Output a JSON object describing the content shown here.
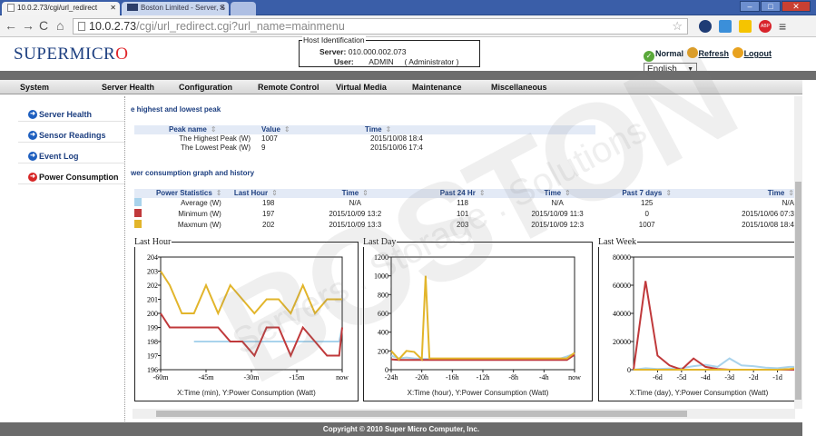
{
  "browser": {
    "tabs": [
      {
        "label": "10.0.2.73/cgi/url_redirect"
      },
      {
        "label": "Boston Limited - Server, S"
      },
      {
        "label": ""
      }
    ],
    "url_host": "10.0.2.73",
    "url_path": "/cgi/url_redirect.cgi?url_name=mainmenu",
    "abp": "ABP"
  },
  "header": {
    "logo": "SUPERMICR",
    "logo_o": "O",
    "host_title": "Host Identification",
    "server_label": "Server:",
    "server_value": "010.000.002.073",
    "user_label": "User:",
    "user_value": "ADMIN",
    "user_role": "( Administrator )",
    "status_text": "Normal",
    "refresh": "Refresh",
    "logout": "Logout",
    "language": "English"
  },
  "nav": [
    "System",
    "Server Health",
    "Configuration",
    "Remote Control",
    "Virtual Media",
    "Maintenance",
    "Miscellaneous"
  ],
  "sidebar": [
    "Server Health",
    "Sensor Readings",
    "Event Log",
    "Power Consumption"
  ],
  "peak_section": {
    "title": "e highest and lowest peak",
    "headers": [
      "Peak name",
      "Value",
      "Time"
    ],
    "rows": [
      [
        "The Highest Peak (W)",
        "1007",
        "2015/10/08 18:4"
      ],
      [
        "The Lowest Peak (W)",
        "9",
        "2015/10/06 17:4"
      ]
    ]
  },
  "power_section": {
    "title": "wer consumption graph and history",
    "headers": [
      "Power Statistics",
      "Last Hour",
      "Time",
      "Past 24 Hr",
      "Time",
      "Past 7 days",
      "Time"
    ],
    "rows": [
      {
        "color": "#a9d3ec",
        "cells": [
          "Average (W)",
          "198",
          "N/A",
          "118",
          "N/A",
          "125",
          "N/A"
        ]
      },
      {
        "color": "#c0393b",
        "cells": [
          "Minimum (W)",
          "197",
          "2015/10/09 13:2",
          "101",
          "2015/10/09 11:3",
          "0",
          "2015/10/06 07:3"
        ]
      },
      {
        "color": "#e2b52b",
        "cells": [
          "Maxmum (W)",
          "202",
          "2015/10/09 13:3",
          "203",
          "2015/10/09 12:3",
          "1007",
          "2015/10/08 18:4"
        ]
      }
    ]
  },
  "charts": {
    "last_hour": {
      "title": "Last Hour",
      "caption": "X:Time (min), Y:Power Consumption (Watt)"
    },
    "last_day": {
      "title": "Last Day",
      "caption": "X:Time (hour), Y:Power Consumption (Watt)"
    },
    "last_week": {
      "title": "Last Week",
      "caption": "X:Time (day), Y:Power Consumption (Watt)"
    }
  },
  "chart_data": [
    {
      "type": "line",
      "title": "Last Hour",
      "xlabel": "X:Time (min), Y:Power Consumption (Watt)",
      "x_ticks": [
        "-60m",
        "-45m",
        "-30m",
        "-15m",
        "now"
      ],
      "y_ticks": [
        196,
        197,
        198,
        199,
        200,
        201,
        202,
        203,
        204
      ],
      "ylim": [
        196,
        204
      ],
      "x": [
        -60,
        -57,
        -53,
        -49,
        -45,
        -41,
        -37,
        -33,
        -29,
        -25,
        -21,
        -17,
        -13,
        -9,
        -5,
        -1,
        0
      ],
      "series": [
        {
          "color": "#a9d3ec",
          "values": [
            null,
            null,
            null,
            198,
            198,
            198,
            198,
            198,
            198,
            198,
            198,
            198,
            198,
            198,
            198,
            198,
            199
          ]
        },
        {
          "color": "#c0393b",
          "values": [
            200,
            199,
            199,
            199,
            199,
            199,
            198,
            198,
            197,
            199,
            199,
            197,
            199,
            198,
            197,
            197,
            199
          ]
        },
        {
          "color": "#e2b52b",
          "values": [
            203,
            202,
            200,
            200,
            202,
            200,
            202,
            201,
            200,
            201,
            201,
            200,
            202,
            200,
            201,
            201,
            201
          ]
        }
      ]
    },
    {
      "type": "line",
      "title": "Last Day",
      "xlabel": "X:Time (hour), Y:Power Consumption (Watt)",
      "x_ticks": [
        "-24h",
        "-20h",
        "-16h",
        "-12h",
        "-8h",
        "-4h",
        "now"
      ],
      "y_ticks": [
        0,
        200,
        400,
        600,
        800,
        1000,
        1200
      ],
      "ylim": [
        0,
        1200
      ],
      "x": [
        -24,
        -23,
        -22,
        -21,
        -20,
        -19.5,
        -19,
        -18,
        -17,
        -16,
        -14,
        -12,
        -10,
        -8,
        -6,
        -4,
        -2,
        -1,
        0
      ],
      "series": [
        {
          "color": "#a9d3ec",
          "values": [
            150,
            120,
            130,
            120,
            115,
            115,
            115,
            115,
            115,
            115,
            115,
            115,
            115,
            115,
            115,
            115,
            115,
            140,
            170
          ]
        },
        {
          "color": "#c0393b",
          "values": [
            110,
            105,
            105,
            105,
            105,
            105,
            105,
            105,
            105,
            105,
            105,
            105,
            105,
            105,
            105,
            105,
            105,
            105,
            160
          ]
        },
        {
          "color": "#e2b52b",
          "values": [
            200,
            110,
            200,
            190,
            110,
            1000,
            120,
            120,
            120,
            120,
            120,
            120,
            120,
            120,
            120,
            120,
            120,
            120,
            180
          ]
        }
      ]
    },
    {
      "type": "line",
      "title": "Last Week",
      "xlabel": "X:Time (day), Y:Power Consumption (Watt)",
      "x_ticks": [
        "-6d",
        "-5d",
        "-4d",
        "-3d",
        "-2d",
        "-1d"
      ],
      "y_ticks": [
        0,
        20000,
        40000,
        60000,
        80000
      ],
      "ylim": [
        0,
        80000
      ],
      "x": [
        -7,
        -6.5,
        -6,
        -5.5,
        -5,
        -4.5,
        -4,
        -3.5,
        -3,
        -2.5,
        -2,
        -1.5,
        -1,
        -0.5,
        0
      ],
      "series": [
        {
          "color": "#a9d3ec",
          "values": [
            0,
            1000,
            500,
            800,
            1000,
            2500,
            3500,
            2000,
            8000,
            3000,
            2500,
            1500,
            1000,
            2000,
            2000
          ]
        },
        {
          "color": "#c0393b",
          "values": [
            0,
            63000,
            10000,
            3000,
            0,
            8000,
            2000,
            500,
            0,
            0,
            0,
            0,
            0,
            0,
            0
          ]
        },
        {
          "color": "#e2b52b",
          "values": [
            0,
            0,
            0,
            0,
            0,
            0,
            0,
            0,
            0,
            0,
            0,
            0,
            0,
            500,
            1500
          ]
        }
      ]
    }
  ],
  "footer": "Copyright © 2010 Super Micro Computer, Inc.",
  "watermark": "BOSTON",
  "watermark_sub": "Servers . Storage . Solutions"
}
